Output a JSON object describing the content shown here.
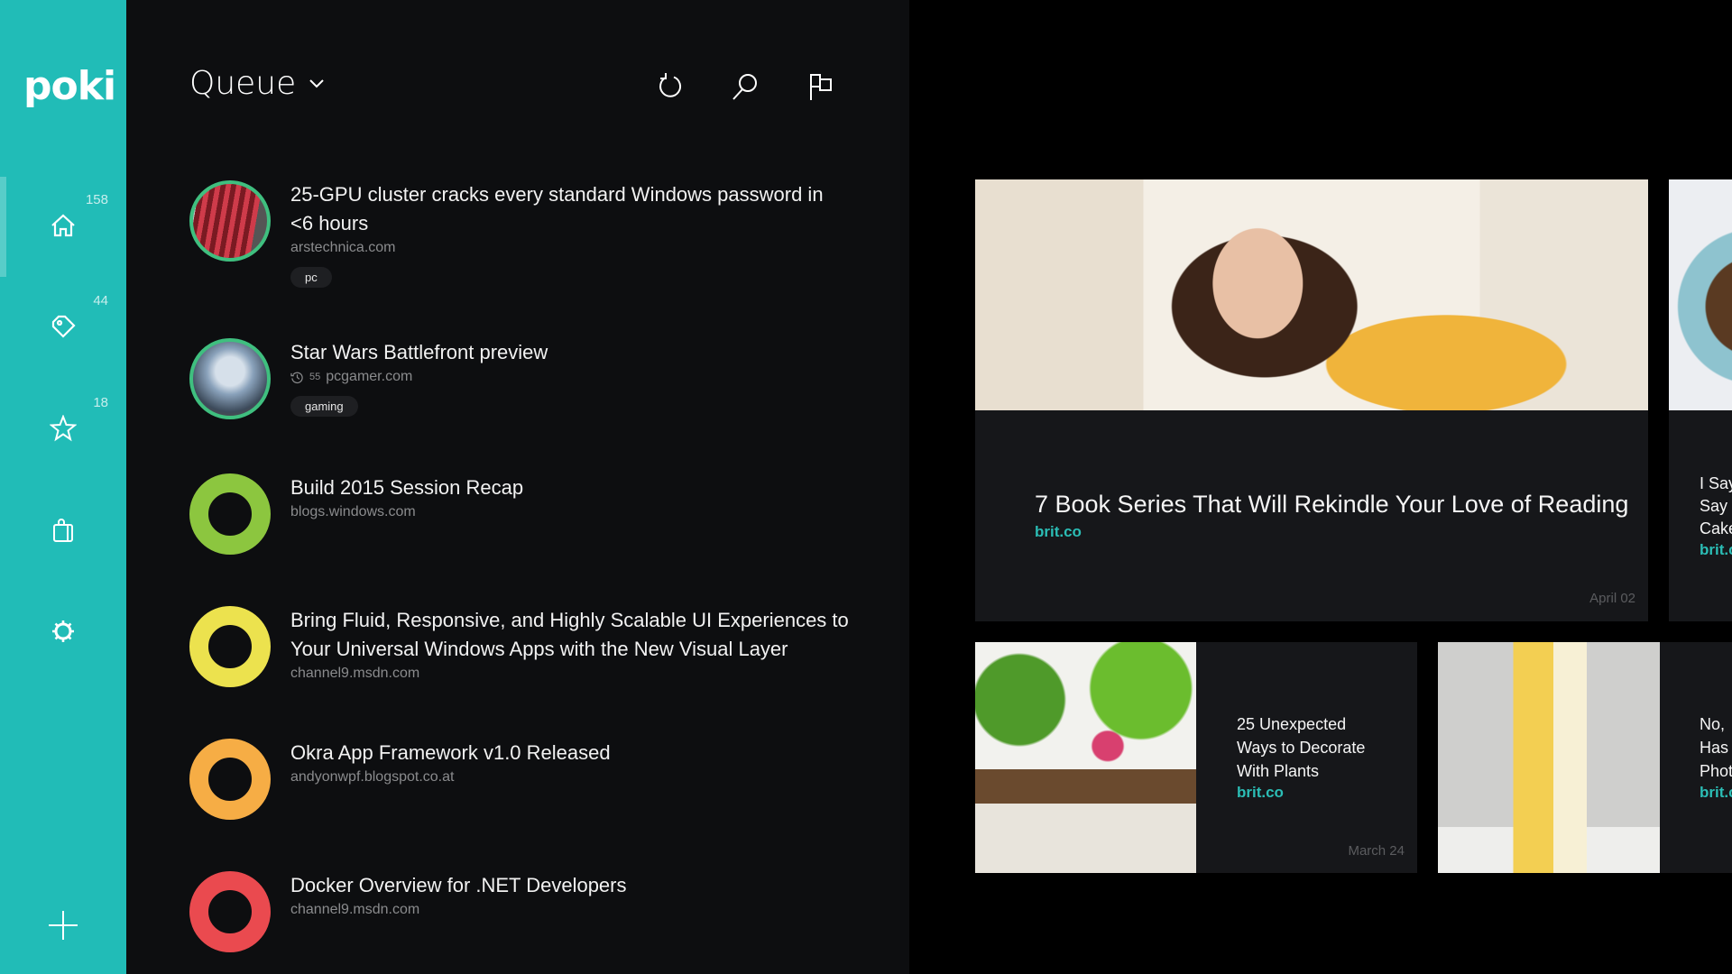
{
  "app": {
    "name": "poki",
    "accent": "#21bcb7"
  },
  "sidebar": {
    "items": [
      {
        "name": "home",
        "icon": "home-icon",
        "count": "158",
        "selected": true
      },
      {
        "name": "tags",
        "icon": "tag-icon",
        "count": "44",
        "selected": false
      },
      {
        "name": "favorites",
        "icon": "star-icon",
        "count": "18",
        "selected": false
      },
      {
        "name": "store",
        "icon": "shopping-bag-icon",
        "count": "",
        "selected": false
      },
      {
        "name": "settings",
        "icon": "gear-icon",
        "count": "",
        "selected": false
      }
    ],
    "add_icon": "plus-icon"
  },
  "queue": {
    "title": "Queue",
    "toolbar": {
      "refresh_icon": "refresh-icon",
      "search_icon": "search-icon",
      "flag_icon": "flag-icon"
    },
    "items": [
      {
        "title": "25-GPU cluster cracks every standard Windows password in <6 hours",
        "source": "arstechnica.com",
        "tag": "pc",
        "thumb": "image",
        "ring_color": "#3fbf7f"
      },
      {
        "title": "Star Wars Battlefront preview",
        "source": "pcgamer.com",
        "read_time": "55",
        "tag": "gaming",
        "thumb": "image",
        "ring_color": "#3fbf7f"
      },
      {
        "title": "Build 2015 Session Recap",
        "source": "blogs.windows.com",
        "ring_color": "#8cc63f"
      },
      {
        "title": "Bring Fluid, Responsive, and Highly Scalable UI Experiences to Your Universal Windows Apps with the New Visual Layer",
        "source": "channel9.msdn.com",
        "ring_color": "#ece24e"
      },
      {
        "title": "Okra App Framework v1.0 Released",
        "source": "andyonwpf.blogspot.co.at",
        "ring_color": "#f6ad45"
      },
      {
        "title": "Docker Overview for .NET Developers",
        "source": "channel9.msdn.com",
        "ring_color": "#ea4a4f"
      }
    ]
  },
  "cards": {
    "featured": {
      "title": "7 Book Series That Will Rekindle Your Love of Reading",
      "source": "brit.co",
      "date": "April 02"
    },
    "featured_next": {
      "title_lines": [
        "I Say",
        "Say",
        "Cake"
      ],
      "source": "brit.c"
    },
    "small": [
      {
        "title_lines": [
          "25 Unexpected",
          "Ways to Decorate",
          "With Plants"
        ],
        "source": "brit.co",
        "date": "March 24"
      },
      {
        "title_lines": [
          "No,",
          "Has",
          "Phot"
        ],
        "source": "brit.c"
      }
    ]
  }
}
